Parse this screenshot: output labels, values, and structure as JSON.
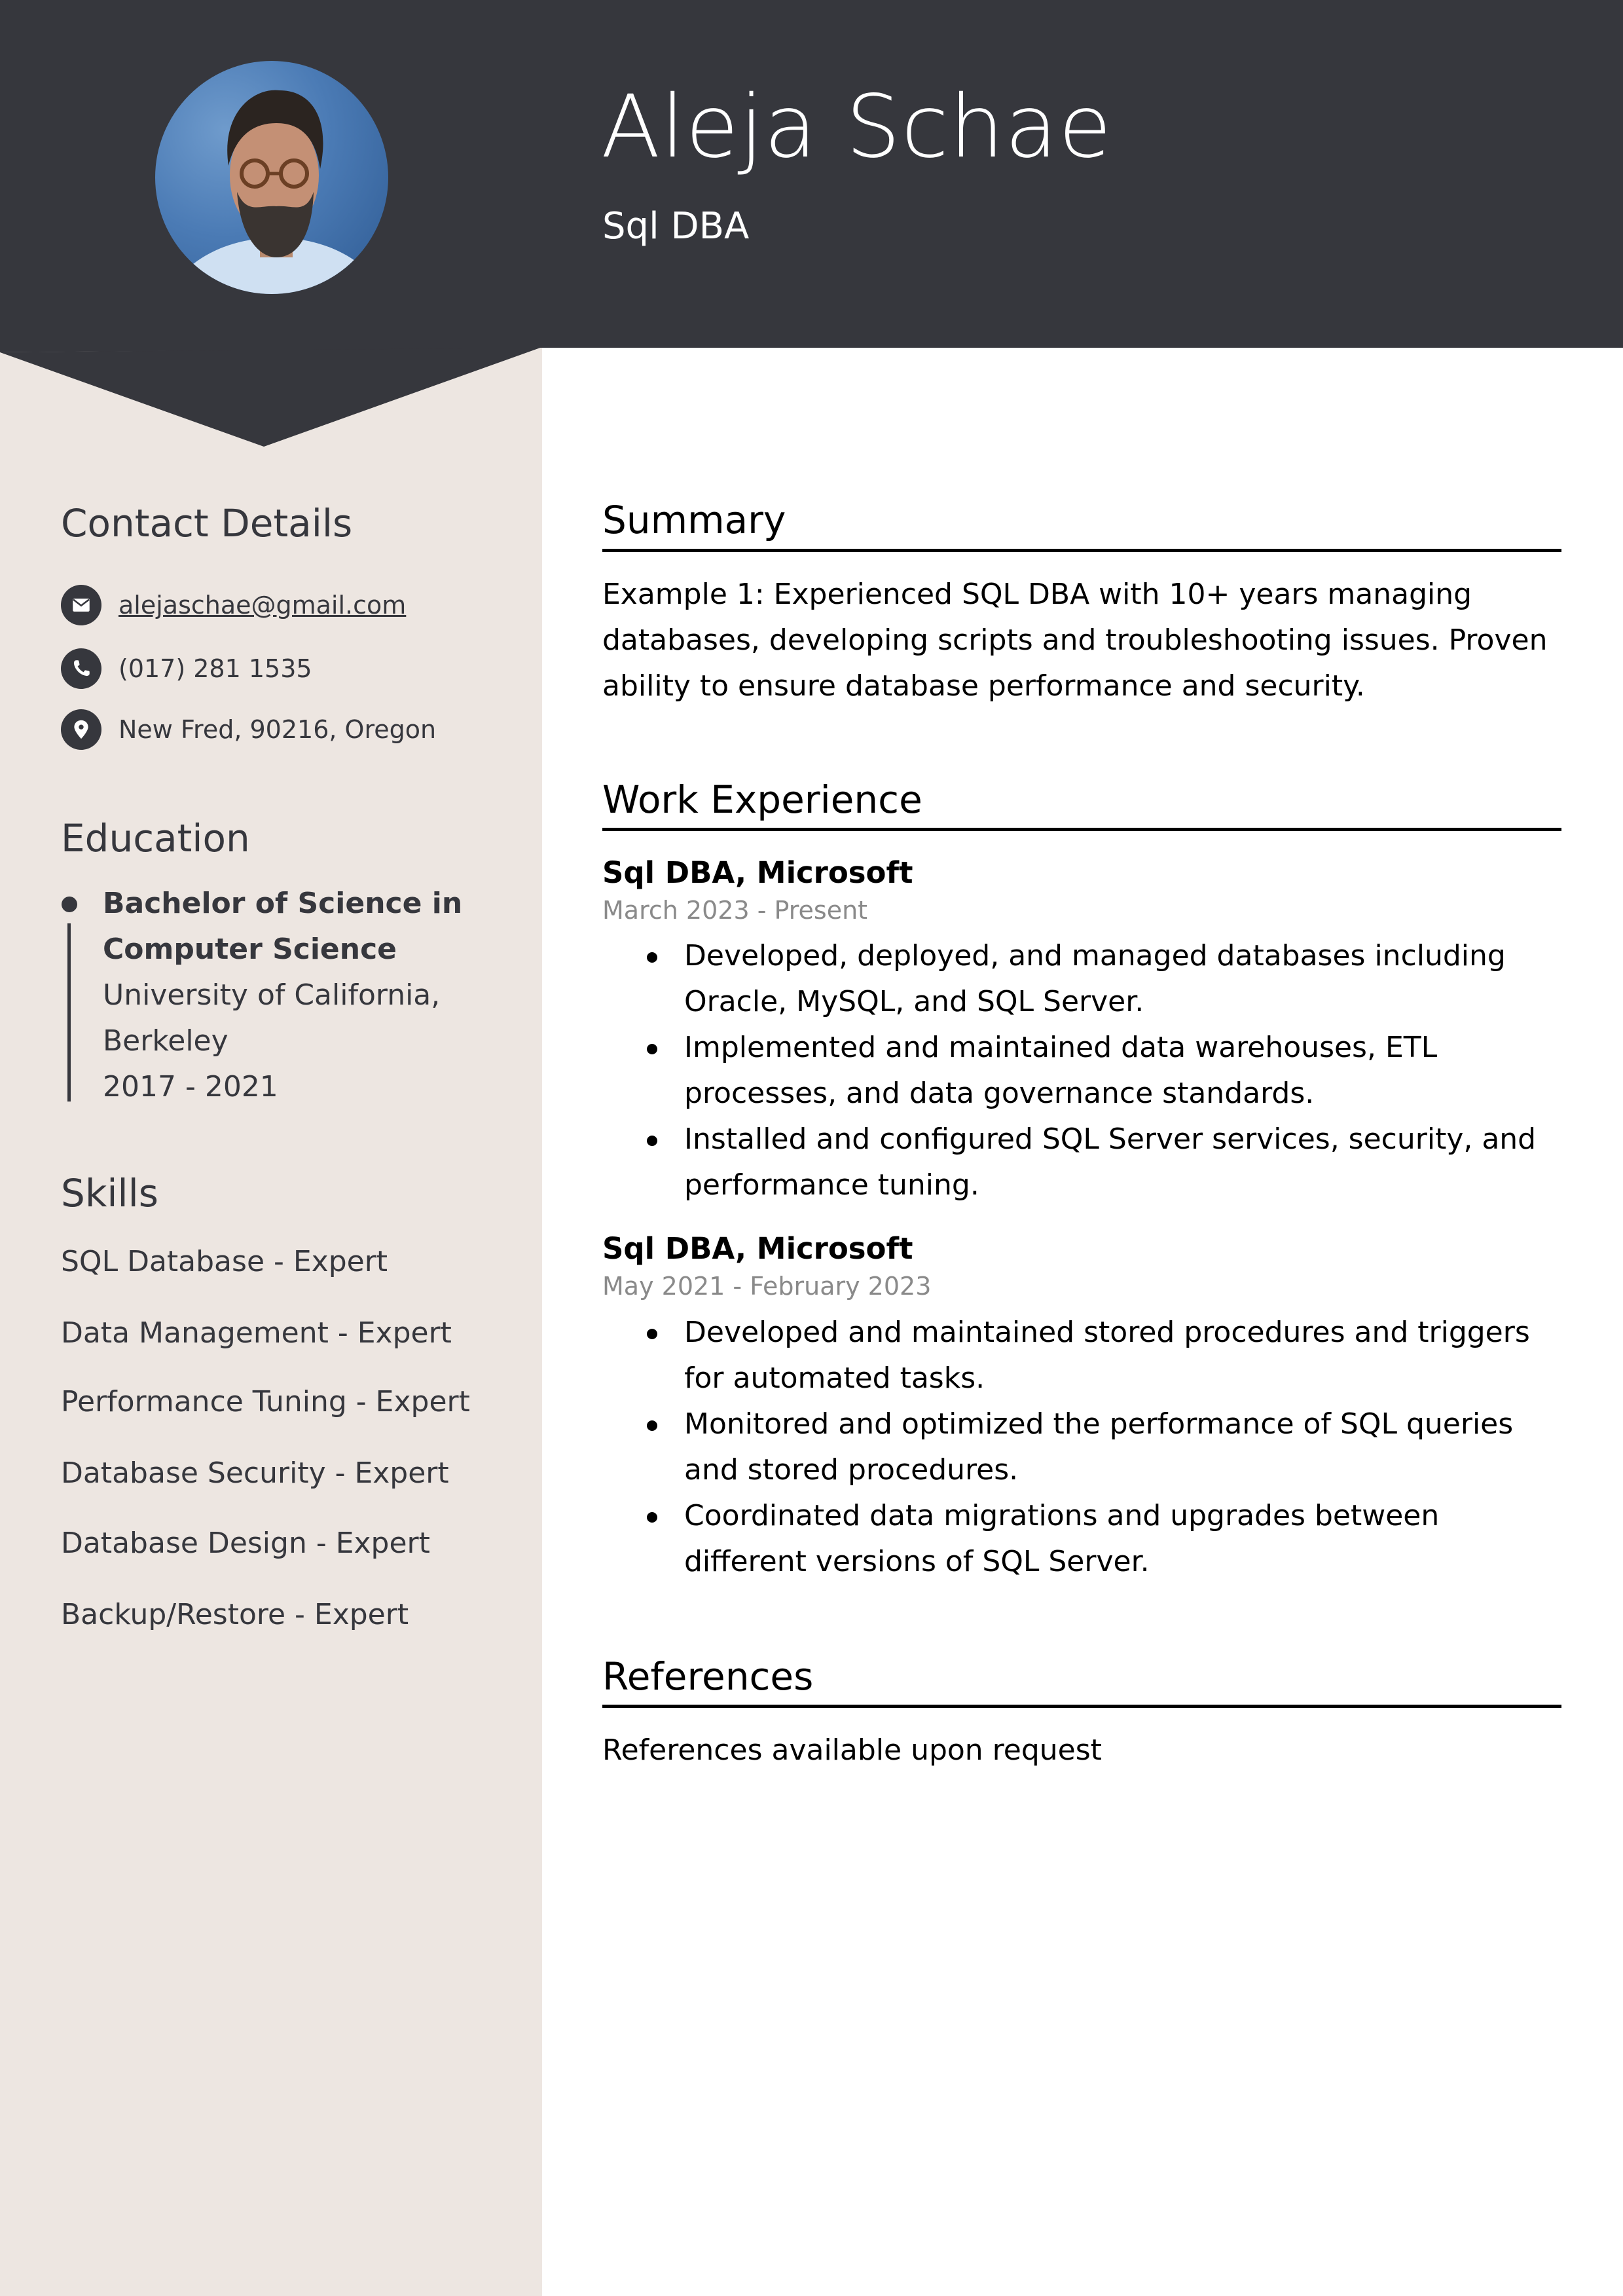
{
  "header": {
    "name": "Aleja Schae",
    "role": "Sql DBA",
    "avatar_icon": "profile-photo"
  },
  "colors": {
    "header_bg": "#36373d",
    "sidebar_bg": "#ede6e1",
    "text_dark": "#36373d",
    "date_gray": "#8a8a8a"
  },
  "sidebar": {
    "contact": {
      "title": "Contact Details",
      "items": [
        {
          "icon": "envelope-icon",
          "text": "alejaschae@gmail.com"
        },
        {
          "icon": "phone-icon",
          "text": "(017) 281 1535"
        },
        {
          "icon": "map-pin-icon",
          "text": "New Fred, 90216, Oregon"
        }
      ]
    },
    "education": {
      "title": "Education",
      "degree": "Bachelor of Science in Computer Science",
      "school": "University of California, Berkeley",
      "years": "2017 - 2021"
    },
    "skills": {
      "title": "Skills",
      "items": [
        "SQL Database - Expert",
        "Data Management - Expert",
        "Performance Tuning - Expert",
        "Database Security - Expert",
        "Database Design - Expert",
        "Backup/Restore - Expert"
      ]
    }
  },
  "main": {
    "summary": {
      "title": "Summary",
      "text": "Example 1: Experienced SQL DBA with 10+ years managing databases, developing scripts and troubleshooting issues. Proven ability to ensure database performance and security."
    },
    "experience": {
      "title": "Work Experience",
      "jobs": [
        {
          "title": "Sql DBA, Microsoft",
          "dates": "March 2023 - Present",
          "bullets": [
            "Developed, deployed, and managed databases including Oracle, MySQL, and SQL Server.",
            "Implemented and maintained data warehouses, ETL processes, and data governance standards.",
            "Installed and configured SQL Server services, security, and performance tuning."
          ]
        },
        {
          "title": "Sql DBA, Microsoft",
          "dates": "May 2021 - February 2023",
          "bullets": [
            "Developed and maintained stored procedures and triggers for automated tasks.",
            "Monitored and optimized the performance of SQL queries and stored procedures.",
            "Coordinated data migrations and upgrades between different versions of SQL Server."
          ]
        }
      ]
    },
    "references": {
      "title": "References",
      "text": "References available upon request"
    }
  }
}
